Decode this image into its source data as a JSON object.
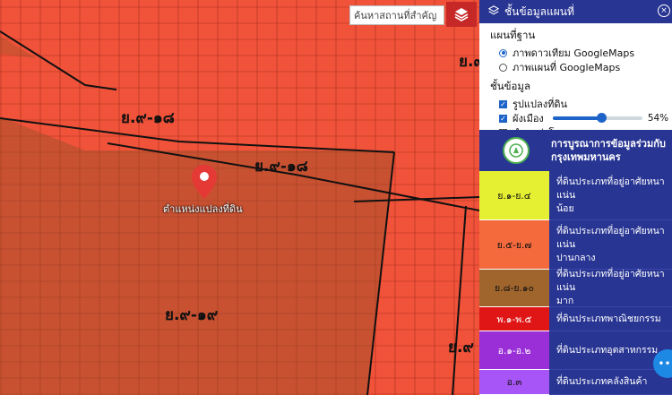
{
  "map": {
    "search_placeholder": "ค้นหาสถานที่สำคัญ",
    "pin_label": "ตำแหน่งแปลงที่ดิน",
    "zone_labels": [
      "ย.๙-๑๘",
      "ย.๙-๑๘",
      "ย.๙-๑๙",
      "ย.๙",
      "ย.๙"
    ]
  },
  "panel": {
    "header_title": "ชั้นข้อมูลแผนที่",
    "basemap_title": "แผนที่ฐาน",
    "basemap_options": [
      "ภาพดาวเทียม GoogleMaps",
      "ภาพแผนที่ GoogleMaps"
    ],
    "basemap_selected": 0,
    "layers_title": "ชั้นข้อมูล",
    "layers": [
      {
        "label": "รูปแปลงที่ดิน",
        "checked": true
      },
      {
        "label": "ผังเมือง",
        "checked": true
      },
      {
        "label": "ตำแหน่งโคกหนองนา",
        "checked": false
      }
    ],
    "opacity_value": "54%",
    "opacity_fraction": 0.54,
    "agency_name_line1": "การบูรณาการข้อมูลร่วมกับ",
    "agency_name_line2": "กรุงเทพมหานคร"
  },
  "legend": [
    {
      "code": "ย.๑-ย.๔",
      "desc_line1": "ที่ดินประเภทที่อยู่อาศัยหนาแน่น",
      "desc_line2": "น้อย",
      "color": "#e6f032",
      "text_color": "#111111"
    },
    {
      "code": "ย.๕-ย.๗",
      "desc_line1": "ที่ดินประเภทที่อยู่อาศัยหนาแน่น",
      "desc_line2": "ปานกลาง",
      "color": "#f46a3c",
      "text_color": "#111111"
    },
    {
      "code": "ย.๘-ย.๑๐",
      "desc_line1": "ที่ดินประเภทที่อยู่อาศัยหนาแน่น",
      "desc_line2": "มาก",
      "color": "#a0652d",
      "text_color": "#111111"
    },
    {
      "code": "พ.๑-พ.๕",
      "desc_line1": "ที่ดินประเภทพาณิชยกรรม",
      "desc_line2": "",
      "color": "#e01616",
      "text_color": "#ffffff"
    },
    {
      "code": "อ.๑-อ.๒",
      "desc_line1": "ที่ดินประเภทอุตสาหกรรม",
      "desc_line2": "",
      "color": "#9a2fd8",
      "text_color": "#ffffff"
    },
    {
      "code": "อ.๓",
      "desc_line1": "ที่ดินประเภทคลังสินค้า",
      "desc_line2": "",
      "color": "#a855f7",
      "text_color": "#111111"
    }
  ],
  "colors": {
    "panel_header": "#283593",
    "accent": "#1e64c8",
    "pin": "#e53935"
  }
}
